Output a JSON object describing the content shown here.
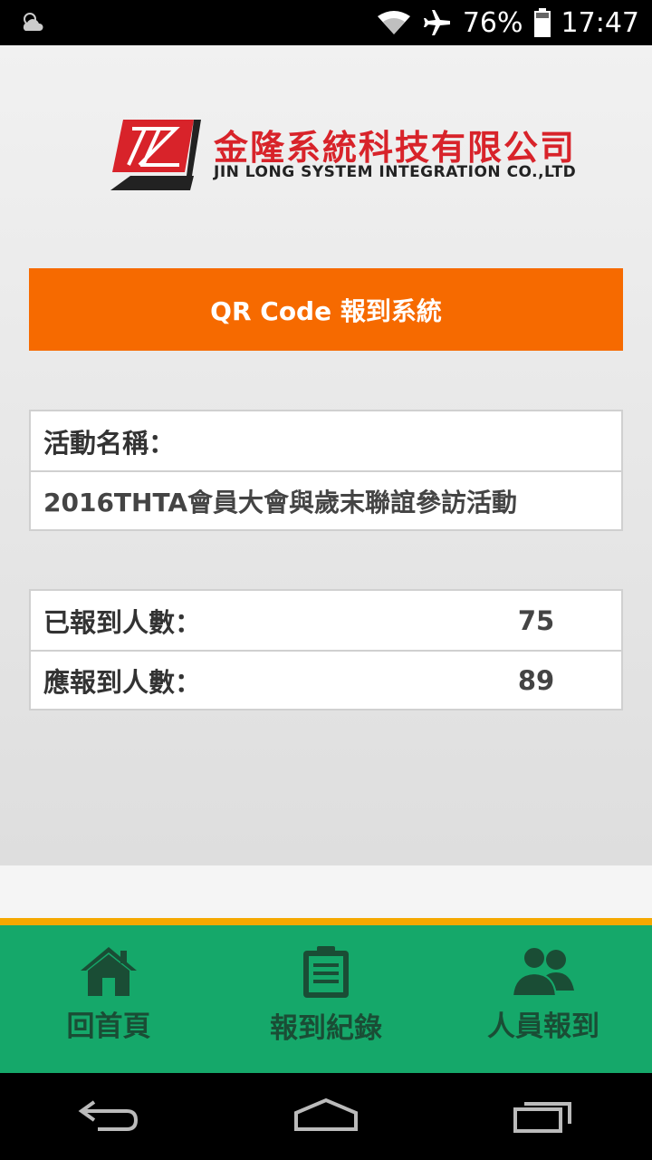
{
  "status_bar": {
    "weather_icon": "partly-cloudy-icon",
    "wifi_icon": "wifi-icon",
    "airplane_icon": "airplane-mode-icon",
    "battery_percent": "76%",
    "battery_icon": "battery-icon",
    "time": "17:47"
  },
  "logo": {
    "name_cn": "金隆系統科技有限公司",
    "name_en": "JIN LONG SYSTEM INTEGRATION CO.,LTD",
    "brand_color": "#d8232a"
  },
  "header": {
    "title": "QR Code 報到系統",
    "color": "#f66a00"
  },
  "event": {
    "label": "活動名稱：",
    "name": "2016THTA會員大會與歲末聯誼參訪活動"
  },
  "counts": {
    "checked_in_label": "已報到人數：",
    "checked_in_value": "75",
    "expected_label": "應報到人數：",
    "expected_value": "89"
  },
  "bottom_nav": {
    "bg_color": "#15a86a",
    "accent_color": "#f5a800",
    "items": [
      {
        "label": "回首頁",
        "icon": "home-icon"
      },
      {
        "label": "報到紀錄",
        "icon": "clipboard-icon"
      },
      {
        "label": "人員報到",
        "icon": "people-icon"
      }
    ]
  },
  "system_nav": {
    "back_icon": "back-icon",
    "home_icon": "home-button-icon",
    "recents_icon": "recents-icon"
  }
}
